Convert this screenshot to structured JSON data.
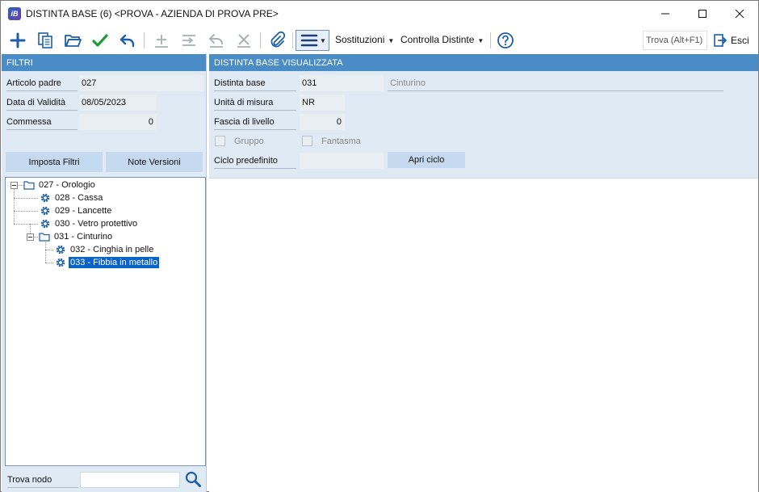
{
  "window": {
    "title": "DISTINTA BASE (6) <PROVA - AZIENDA DI PROVA PRE>",
    "logo_text": "iB"
  },
  "toolbar": {
    "sostituzioni": "Sostituzioni",
    "controlla_distinte": "Controlla Distinte",
    "search_placeholder": "Trova (Alt+F1)",
    "exit_label": "Esci"
  },
  "filters": {
    "header": "FILTRI",
    "articolo_padre_label": "Articolo padre",
    "articolo_padre_value": "027",
    "data_validita_label": "Data di Validità",
    "data_validita_value": "08/05/2023",
    "commessa_label": "Commessa",
    "commessa_value": "0",
    "imposta_filtri": "Imposta Filtri",
    "note_versioni": "Note Versioni"
  },
  "tree": {
    "nodes": [
      {
        "label": "027 - Orologio",
        "type": "folder"
      },
      {
        "label": "028 - Cassa",
        "type": "gear"
      },
      {
        "label": "029 - Lancette",
        "type": "gear"
      },
      {
        "label": "030 - Vetro protettivo",
        "type": "gear"
      },
      {
        "label": "031 - Cinturino",
        "type": "folder"
      },
      {
        "label": "032 - Cinghia in pelle",
        "type": "gear"
      },
      {
        "label": "033 - Fibbia in metallo",
        "type": "gear",
        "selected": true
      }
    ],
    "find_label": "Trova nodo"
  },
  "details": {
    "header": "DISTINTA BASE VISUALIZZATA",
    "distinta_label": "Distinta base",
    "distinta_code": "031",
    "distinta_desc": "Cinturino",
    "unita_label": "Unità di misura",
    "unita_value": "NR",
    "fascia_label": "Fascia di livello",
    "fascia_value": "0",
    "gruppo_label": "Gruppo",
    "fantasma_label": "Fantasma",
    "ciclo_label": "Ciclo predefinito",
    "ciclo_value": "",
    "apri_ciclo": "Apri ciclo"
  },
  "colors": {
    "header_blue": "#4a8cc6",
    "panel_bg": "#dfeaf5",
    "selection": "#0a64c8",
    "icon_blue": "#1f5fa8",
    "check_green": "#1e9a3a"
  }
}
